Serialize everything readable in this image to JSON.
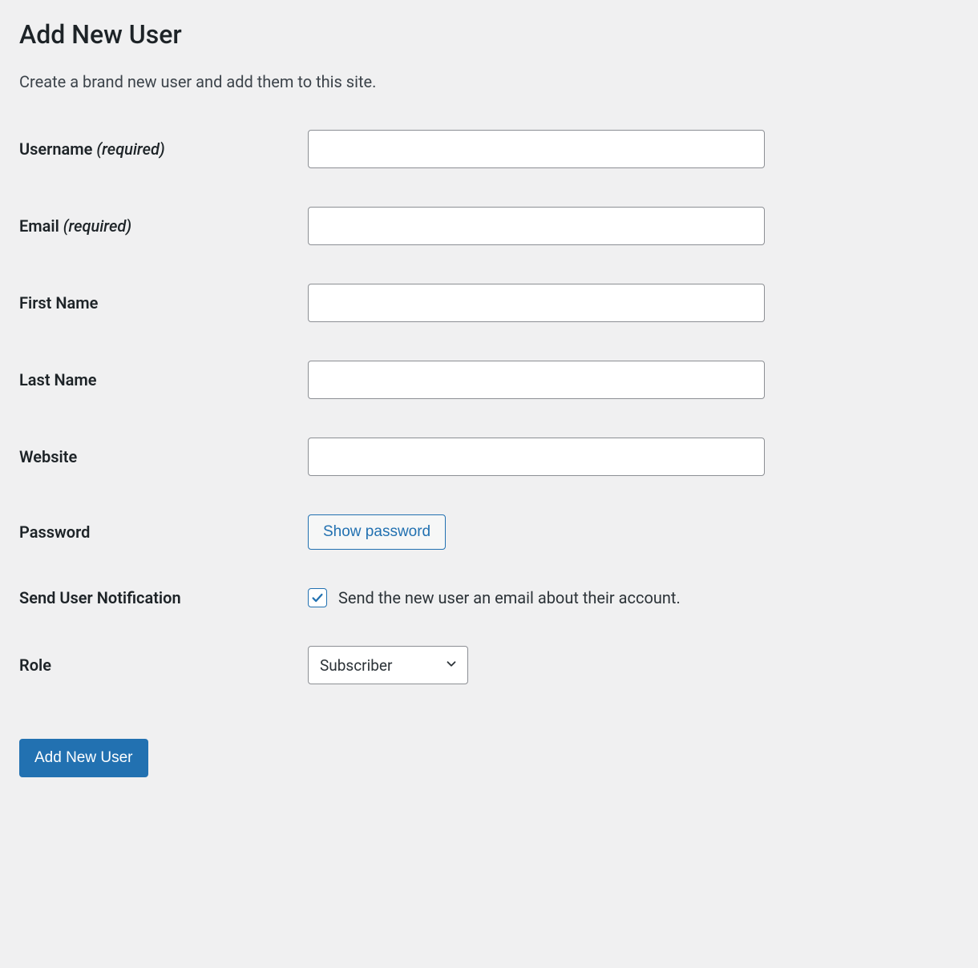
{
  "page": {
    "title": "Add New User",
    "description": "Create a brand new user and add them to this site."
  },
  "form": {
    "username": {
      "label": "Username",
      "required_label": "(required)",
      "value": ""
    },
    "email": {
      "label": "Email",
      "required_label": "(required)",
      "value": ""
    },
    "first_name": {
      "label": "First Name",
      "value": ""
    },
    "last_name": {
      "label": "Last Name",
      "value": ""
    },
    "website": {
      "label": "Website",
      "value": ""
    },
    "password": {
      "label": "Password",
      "button_label": "Show password"
    },
    "notification": {
      "label": "Send User Notification",
      "checkbox_label": "Send the new user an email about their account.",
      "checked": true
    },
    "role": {
      "label": "Role",
      "selected": "Subscriber"
    },
    "submit_label": "Add New User"
  }
}
